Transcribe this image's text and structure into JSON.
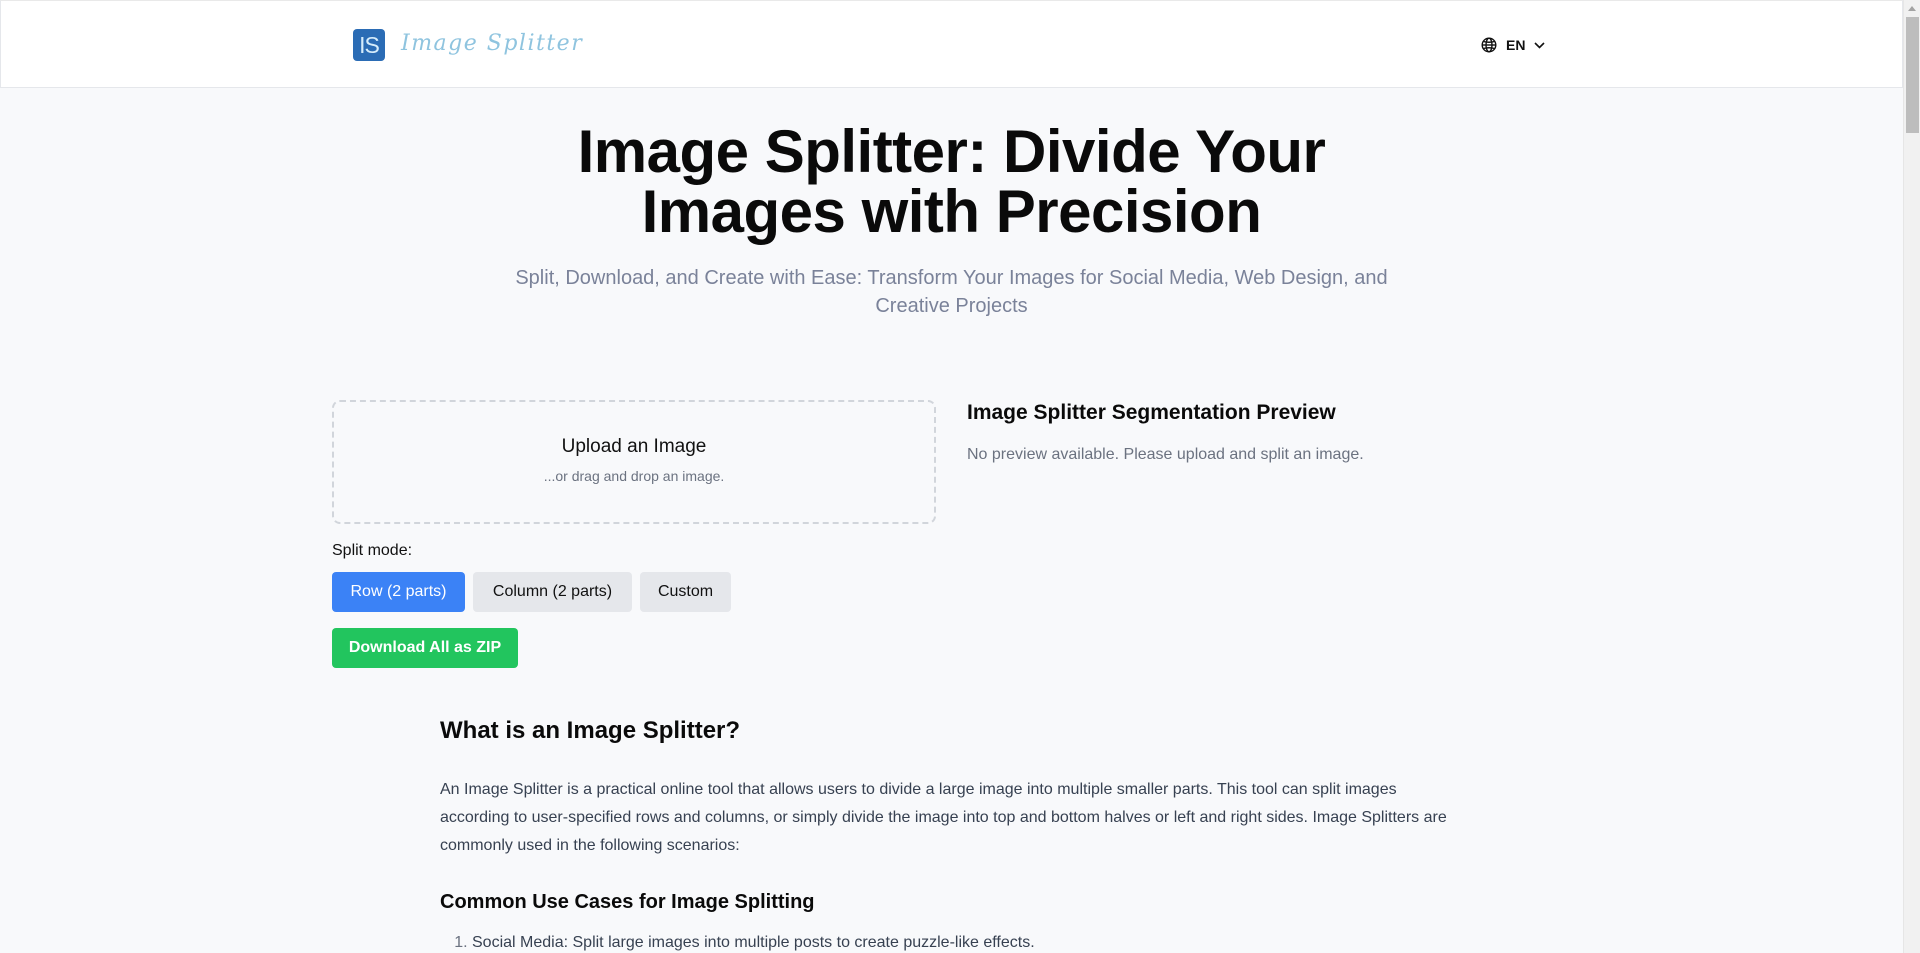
{
  "header": {
    "logo_mark": "IS",
    "logo_text": "Image Splitter",
    "language": {
      "icon": "globe-icon",
      "label": "EN",
      "chevron": "chevron-down-icon"
    }
  },
  "hero": {
    "title_line1": "Image Splitter: Divide Your",
    "title_line2": "Images with Precision",
    "subtitle": "Split, Download, and Create with Ease: Transform Your Images for Social Media, Web Design, and Creative Projects"
  },
  "upload": {
    "title": "Upload an Image",
    "subtitle": "...or drag and drop an image."
  },
  "split": {
    "label": "Split mode:",
    "modes": [
      {
        "label": "Row (2 parts)",
        "selected": true
      },
      {
        "label": "Column (2 parts)",
        "selected": false
      },
      {
        "label": "Custom",
        "selected": false
      }
    ],
    "download_label": "Download All as ZIP"
  },
  "preview": {
    "title": "Image Splitter Segmentation Preview",
    "empty_text": "No preview available. Please upload and split an image."
  },
  "article": {
    "heading": "What is an Image Splitter?",
    "paragraph": "An Image Splitter is a practical online tool that allows users to divide a large image into multiple smaller parts. This tool can split images according to user-specified rows and columns, or simply divide the image into top and bottom halves or left and right sides. Image Splitters are commonly used in the following scenarios:",
    "subheading": "Common Use Cases for Image Splitting",
    "use_cases": [
      "Social Media: Split large images into multiple posts to create puzzle-like effects."
    ]
  },
  "colors": {
    "primary": "#3b82f6",
    "success": "#22c55e",
    "logo_box": "#2b6cb5",
    "logo_text": "#8fc4df",
    "background": "#f8f9fb"
  }
}
